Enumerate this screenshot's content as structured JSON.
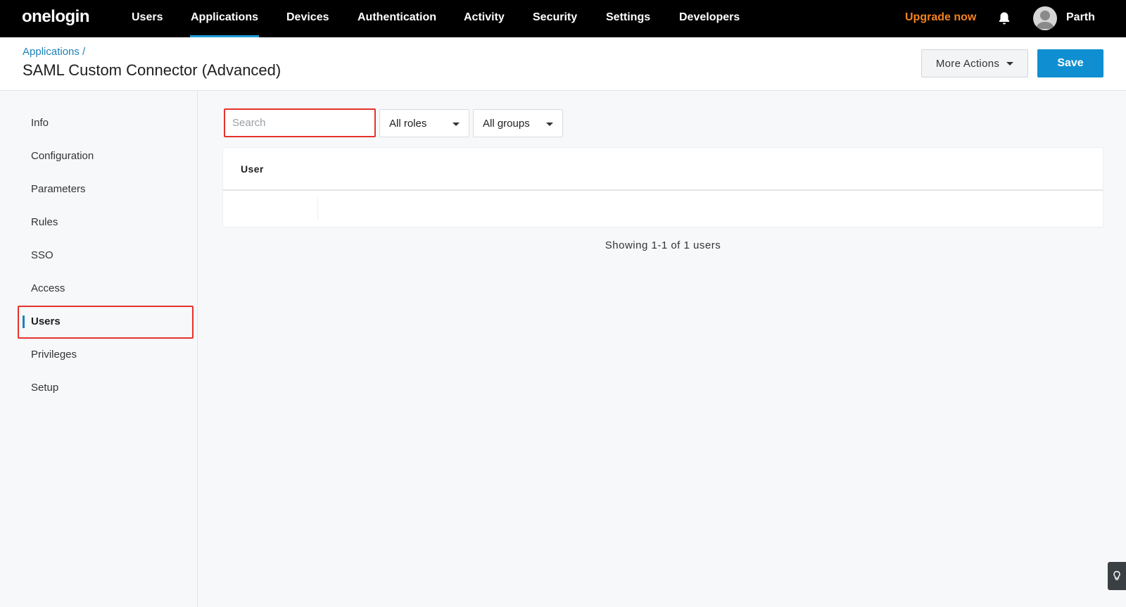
{
  "brand": {
    "logo": "onelogin"
  },
  "topnav": {
    "items": [
      "Users",
      "Applications",
      "Devices",
      "Authentication",
      "Activity",
      "Security",
      "Settings",
      "Developers"
    ],
    "active": "Applications",
    "upgrade_label": "Upgrade now",
    "username": "Parth"
  },
  "header": {
    "breadcrumb": "Applications /",
    "title": "SAML Custom Connector (Advanced)",
    "more_actions_label": "More Actions",
    "save_label": "Save"
  },
  "sidebar": {
    "items": [
      "Info",
      "Configuration",
      "Parameters",
      "Rules",
      "SSO",
      "Access",
      "Users",
      "Privileges",
      "Setup"
    ],
    "active": "Users"
  },
  "filters": {
    "search_placeholder": "Search",
    "roles_value": "All roles",
    "groups_value": "All groups"
  },
  "table": {
    "columns": [
      "User"
    ],
    "rows": [
      [
        ""
      ]
    ]
  },
  "pagination": {
    "summary": "Showing 1-1 of 1 users"
  },
  "colors": {
    "accent": "#0f8fd1",
    "upgrade": "#f5821f",
    "highlight": "#e5322d",
    "nav_bg": "#000000"
  }
}
